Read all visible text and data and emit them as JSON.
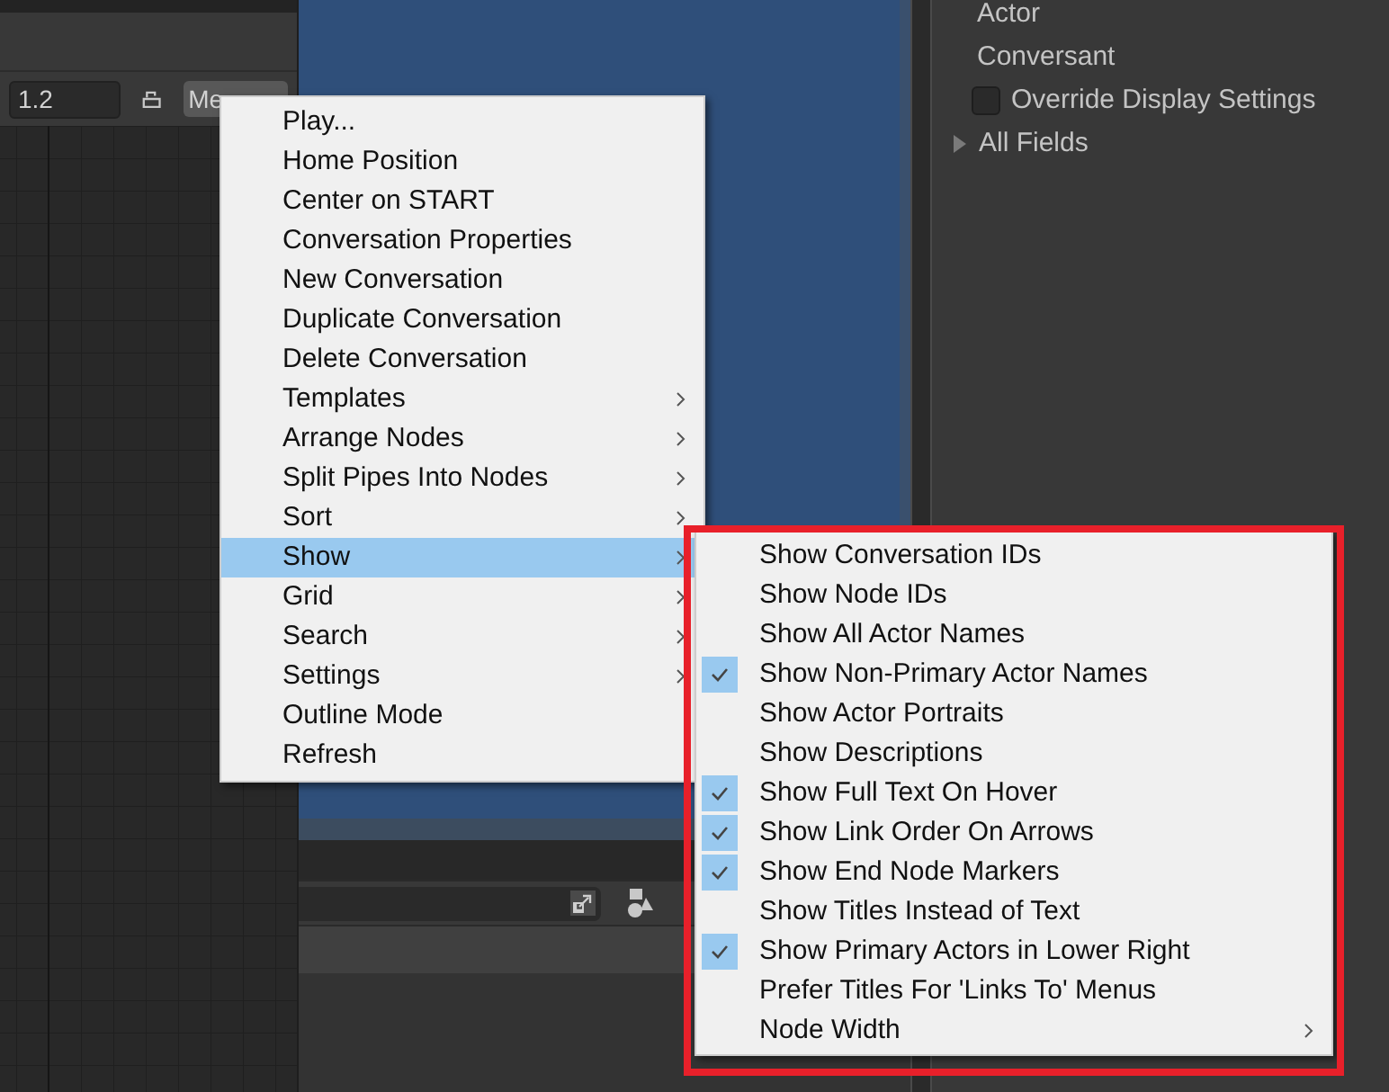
{
  "toolbar": {
    "zoom_field": {
      "value": "1.2"
    },
    "menu_button": {
      "label": "Me"
    }
  },
  "inspector": {
    "items": [
      {
        "kind": "label",
        "label": "Actor"
      },
      {
        "kind": "label",
        "label": "Conversant"
      },
      {
        "kind": "checkbox",
        "label": "Override Display Settings",
        "checked": false
      },
      {
        "kind": "foldout",
        "label": "All Fields",
        "expanded": false
      }
    ]
  },
  "context_menu": {
    "items": [
      {
        "label": "Play...",
        "submenu": false,
        "selected": false
      },
      {
        "label": "Home Position",
        "submenu": false,
        "selected": false
      },
      {
        "label": "Center on START",
        "submenu": false,
        "selected": false
      },
      {
        "label": "Conversation Properties",
        "submenu": false,
        "selected": false
      },
      {
        "label": "New Conversation",
        "submenu": false,
        "selected": false
      },
      {
        "label": "Duplicate Conversation",
        "submenu": false,
        "selected": false
      },
      {
        "label": "Delete Conversation",
        "submenu": false,
        "selected": false
      },
      {
        "label": "Templates",
        "submenu": true,
        "selected": false
      },
      {
        "label": "Arrange Nodes",
        "submenu": true,
        "selected": false
      },
      {
        "label": "Split Pipes Into Nodes",
        "submenu": true,
        "selected": false
      },
      {
        "label": "Sort",
        "submenu": true,
        "selected": false
      },
      {
        "label": "Show",
        "submenu": true,
        "selected": true
      },
      {
        "label": "Grid",
        "submenu": true,
        "selected": false
      },
      {
        "label": "Search",
        "submenu": true,
        "selected": false
      },
      {
        "label": "Settings",
        "submenu": true,
        "selected": false
      },
      {
        "label": "Outline Mode",
        "submenu": false,
        "selected": false
      },
      {
        "label": "Refresh",
        "submenu": false,
        "selected": false
      }
    ]
  },
  "show_submenu": {
    "items": [
      {
        "label": "Show Conversation IDs",
        "checked": false,
        "submenu": false
      },
      {
        "label": "Show Node IDs",
        "checked": false,
        "submenu": false
      },
      {
        "label": "Show All Actor Names",
        "checked": false,
        "submenu": false
      },
      {
        "label": "Show Non-Primary Actor Names",
        "checked": true,
        "submenu": false
      },
      {
        "label": "Show Actor Portraits",
        "checked": false,
        "submenu": false
      },
      {
        "label": "Show Descriptions",
        "checked": false,
        "submenu": false
      },
      {
        "label": "Show Full Text On Hover",
        "checked": true,
        "submenu": false
      },
      {
        "label": "Show Link Order On Arrows",
        "checked": true,
        "submenu": false
      },
      {
        "label": "Show End Node Markers",
        "checked": true,
        "submenu": false
      },
      {
        "label": "Show Titles Instead of Text",
        "checked": false,
        "submenu": false
      },
      {
        "label": "Show Primary Actors in Lower Right",
        "checked": true,
        "submenu": false
      },
      {
        "label": "Prefer Titles For 'Links To' Menus",
        "checked": false,
        "submenu": false
      },
      {
        "label": "Node Width",
        "checked": false,
        "submenu": true
      }
    ]
  }
}
